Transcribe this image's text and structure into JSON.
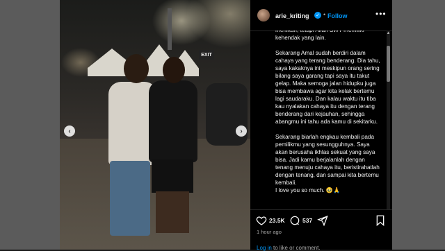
{
  "post": {
    "username": "arie_kriting",
    "follow_label": "Follow",
    "verified_icon": "verified-badge-icon",
    "more_icon": "more-options-icon"
  },
  "photo": {
    "exit_sign_text": "EXIT",
    "nav_prev_icon": "chevron-left-icon",
    "nav_next_icon": "chevron-right-icon"
  },
  "caption": {
    "paragraphs": [
      "menikah, tetapi Allah SWT memiliki kehendak yang lain.",
      "Sekarang Amal sudah berdiri dalam cahaya yang terang benderang. Dia tahu, saya kakaknya ini meskipun orang sering bilang saya garang tapi saya itu takut gelap. Maka semoga jalan hidupku juga bisa membawa agar kita kelak bertemu lagi saudaraku. Dan kalau waktu itu tiba kau nyalakan cahaya itu dengan terang benderang dari kejauhan, sehingga abangmu ini tahu ada kamu di sekitarku.",
      "Sekarang biarlah engkau kembali pada pemilikmu yang sesungguhnya. Saya akan berusaha ikhlas sekuat yang saya bisa. Jadi kamu berjalanlah dengan tenang menuju cahaya itu, beristirahatlah dengan tenang, dan sampai kita bertemu kembali.",
      "I love you so much. 🥹🙏"
    ]
  },
  "actions": {
    "likes": "23.5K",
    "comments": "537",
    "time": "1 hour ago",
    "login_link": "Log in",
    "login_rest": " to like or comment."
  },
  "colors": {
    "accent": "#0095f6",
    "panel_bg": "#000000",
    "page_bg": "#5b5b5b"
  }
}
